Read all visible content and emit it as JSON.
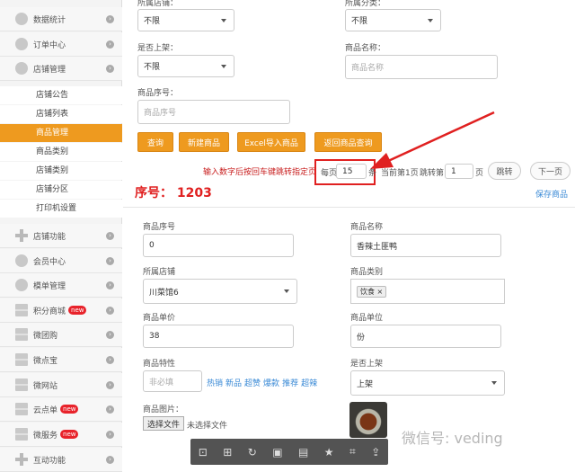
{
  "sidebar": {
    "items": [
      {
        "label": "数据统计",
        "icon": "pie-chart-icon",
        "shape": "circle"
      },
      {
        "label": "订单中心",
        "icon": "orders-icon",
        "shape": "circle"
      },
      {
        "label": "店铺管理",
        "icon": "store-icon",
        "shape": "circle"
      },
      {
        "label": "店铺功能",
        "icon": "plus-icon",
        "shape": "plus"
      },
      {
        "label": "会员中心",
        "icon": "member-icon",
        "shape": "circle"
      },
      {
        "label": "模单管理",
        "icon": "template-icon",
        "shape": "circle"
      },
      {
        "label": "积分商城",
        "icon": "points-icon",
        "shape": "grid",
        "badge": "new"
      },
      {
        "label": "微团购",
        "icon": "group-buy-icon",
        "shape": "grid"
      },
      {
        "label": "微点宝",
        "icon": "wdb-icon",
        "shape": "grid"
      },
      {
        "label": "微网站",
        "icon": "website-icon",
        "shape": "grid"
      },
      {
        "label": "云点单",
        "icon": "cloud-order-icon",
        "shape": "grid",
        "badge": "new"
      },
      {
        "label": "微服务",
        "icon": "service-icon",
        "shape": "grid",
        "badge": "new"
      },
      {
        "label": "互动功能",
        "icon": "plus-icon",
        "shape": "plus"
      }
    ],
    "subitems": [
      {
        "label": "店铺公告"
      },
      {
        "label": "店铺列表"
      },
      {
        "label": "商品管理",
        "active": true
      },
      {
        "label": "商品类别"
      },
      {
        "label": "店铺类别"
      },
      {
        "label": "店铺分区"
      },
      {
        "label": "打印机设置"
      }
    ]
  },
  "filter": {
    "store_label": "所属店铺：",
    "store_value": "不限",
    "category_label": "所属分类：",
    "category_value": "不限",
    "shelf_label": "是否上架：",
    "shelf_value": "不限",
    "name_label": "商品名称：",
    "name_placeholder": "商品名称",
    "seq_label": "商品序号：",
    "seq_placeholder": "商品序号"
  },
  "actions": {
    "query": "查询",
    "new": "新建商品",
    "import": "Excel导入商品",
    "back": "返回商品查询"
  },
  "pagination": {
    "hint": "输入数字后按回车键跳转指定页",
    "per_page_prefix": "每页",
    "per_page_value": "15",
    "per_page_suffix": "条",
    "current": "当前第1页",
    "jump_prefix": "跳转第",
    "jump_value": "1",
    "jump_suffix": "页",
    "jump_button": "跳转",
    "next_button": "下一页"
  },
  "record": {
    "seq_title": "序号：  1203",
    "save": "保存商品"
  },
  "detail": {
    "seq_label": "商品序号",
    "seq_value": "0",
    "name_label": "商品名称",
    "name_value": "香辣土匪鸭",
    "store_label": "所属店铺",
    "store_value": "川菜馆6",
    "category_label": "商品类别",
    "category_tag": "饮食 ×",
    "price_label": "商品单价",
    "price_value": "38",
    "unit_label": "商品单位",
    "unit_value": "份",
    "feature_label": "商品特性",
    "feature_placeholder": "非必填",
    "feature_links": [
      "热销",
      "新品",
      "超赞",
      "爆款",
      "推荐",
      "超辣"
    ],
    "shelf_label": "是否上架",
    "shelf_value": "上架",
    "image_label": "商品图片：",
    "file_button": "选择文件",
    "file_status": "未选择文件"
  },
  "watermark": "微信号: veding",
  "colors": {
    "accent": "#ee9a1f",
    "alert": "#e02020",
    "link": "#3a8ad6"
  }
}
